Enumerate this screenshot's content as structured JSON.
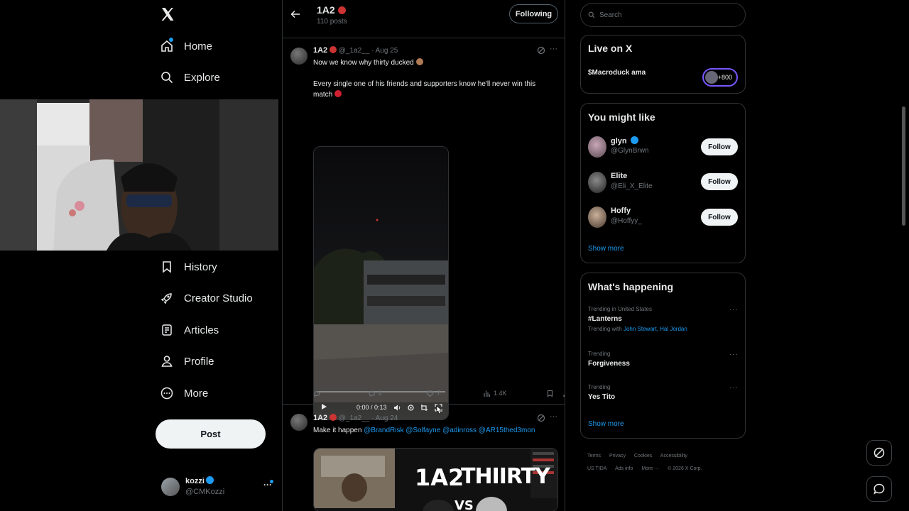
{
  "nav": {
    "items": [
      {
        "label": "Home",
        "icon": "home-icon"
      },
      {
        "label": "Explore",
        "icon": "search-icon"
      },
      {
        "label": "History",
        "icon": "bookmark-icon"
      },
      {
        "label": "Creator Studio",
        "icon": "rocket-icon"
      },
      {
        "label": "Articles",
        "icon": "article-icon"
      },
      {
        "label": "Profile",
        "icon": "person-icon"
      },
      {
        "label": "More",
        "icon": "more-circle-icon"
      }
    ],
    "post_label": "Post",
    "user": {
      "name": "kozzi",
      "handle": "@CMKozzi"
    }
  },
  "header": {
    "title": "1A2",
    "posts_count": "110 posts",
    "following_label": "Following"
  },
  "tweets": [
    {
      "name": "1A2",
      "handle": "@_1a2__",
      "date": "· Aug 25",
      "line1": "Now we know why thirty ducked",
      "line2": "Every single one of his friends and supporters know he'll never win this",
      "line3": "match",
      "video_time": "0:00 / 0:13",
      "video_progress": 0.0,
      "stats": {
        "replies": "",
        "reposts": "2",
        "likes": "7",
        "views": "1.4K"
      }
    },
    {
      "name": "1A2",
      "handle": "@_1a2__",
      "date": "· Aug 24",
      "text_prefix": "Make it happen",
      "mentions": "@BrandRisk @Solfayne @adinross @AR15thed3mon",
      "thumb_text1": "1A2",
      "thumb_text2": "THIIRTY",
      "thumb_text3": "VS"
    }
  ],
  "right": {
    "search_placeholder": "Search",
    "live": {
      "title": "Live on X",
      "item": "$Macroduck ama",
      "count": "+800"
    },
    "wtf": {
      "title": "You might like",
      "follow_label": "Follow",
      "users": [
        {
          "name": "glyn",
          "handle": "@GlynBrwn"
        },
        {
          "name": "Elite",
          "handle": "@Eli_X_Elite"
        },
        {
          "name": "Hoffy",
          "handle": "@Hoffyy_"
        }
      ],
      "show_more": "Show more"
    },
    "happening": {
      "title": "What's happening",
      "trends": [
        {
          "meta": "Trending in United States",
          "name": "#Lanterns",
          "with_prefix": "Trending with",
          "with_links": "John Stewart, Hal Jordan"
        },
        {
          "meta": "Trending",
          "name": "Forgiveness"
        },
        {
          "meta": "Trending",
          "name": "Yes Tito"
        }
      ],
      "show_more": "Show more"
    },
    "footer": {
      "line1": [
        "Terms",
        "Privacy",
        "Cookies",
        "Accessibility"
      ],
      "line2": [
        "US TIDA",
        "Ads info",
        "More ···",
        "© 2026 X Corp."
      ]
    }
  },
  "colors": {
    "accent": "#1d9bf0",
    "border": "#2f3336",
    "muted": "#71767b",
    "text": "#e7e9ea"
  }
}
